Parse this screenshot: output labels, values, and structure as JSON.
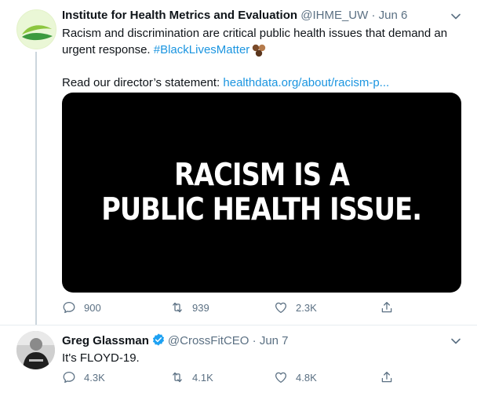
{
  "tweet1": {
    "name": "Institute for Health Metrics and Evaluation",
    "handle": "@IHME_UW",
    "separator": "·",
    "date": "Jun 6",
    "text_line1": "Racism and discrimination are critical public health issues that demand an urgent response.",
    "hashtag": "#BlackLivesMatter",
    "text_line2": "Read our director’s statement:",
    "link": "healthdata.org/about/racism-p...",
    "media": {
      "line1": "RACISM IS A",
      "line2": "PUBLIC HEALTH ISSUE."
    },
    "actions": {
      "replies": "900",
      "retweets": "939",
      "likes": "2.3K"
    }
  },
  "tweet2": {
    "name": "Greg Glassman",
    "handle": "@CrossFitCEO",
    "separator": "·",
    "date": "Jun 7",
    "text": "It's FLOYD-19.",
    "actions": {
      "replies": "4.3K",
      "retweets": "4.1K",
      "likes": "4.8K"
    }
  },
  "colors": {
    "link": "#1b95e0",
    "secondary_text": "#5b7083",
    "verified": "#1da1f2",
    "thread_line": "#ccd6dd"
  }
}
